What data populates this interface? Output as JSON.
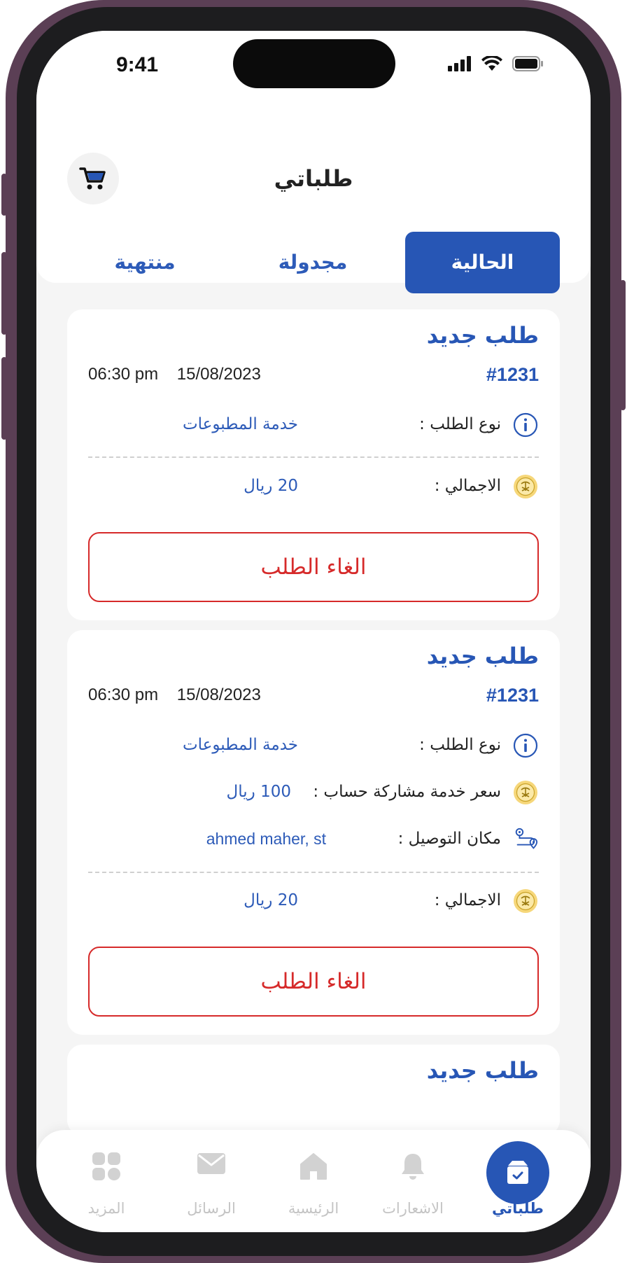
{
  "status_bar": {
    "time": "9:41"
  },
  "header": {
    "title": "طلباتي"
  },
  "tabs": [
    {
      "label": "الحالية",
      "active": true
    },
    {
      "label": "مجدولة",
      "active": false
    },
    {
      "label": "منتهية",
      "active": false
    }
  ],
  "orders": [
    {
      "title": "طلب جديد",
      "id": "#1231",
      "date": "15/08/2023",
      "time": "06:30 pm",
      "type_label": "نوع الطلب :",
      "type_value": "خدمة المطبوعات",
      "total_label": "الاجمالي :",
      "total_value": "20 ريال",
      "cancel_label": "الغاء الطلب"
    },
    {
      "title": "طلب جديد",
      "id": "#1231",
      "date": "15/08/2023",
      "time": "06:30 pm",
      "type_label": "نوع الطلب :",
      "type_value": "خدمة المطبوعات",
      "price_label": "سعر خدمة مشاركة حساب :",
      "price_value": "100 ريال",
      "location_label": "مكان التوصيل :",
      "location_value": "ahmed maher, st",
      "total_label": "الاجمالي :",
      "total_value": "20 ريال",
      "cancel_label": "الغاء الطلب"
    },
    {
      "title": "طلب جديد"
    }
  ],
  "bottom_nav": [
    {
      "label": "طلباتي",
      "icon": "box-icon",
      "active": true
    },
    {
      "label": "الاشعارات",
      "icon": "bell-icon",
      "active": false
    },
    {
      "label": "الرئيسية",
      "icon": "home-icon",
      "active": false
    },
    {
      "label": "الرسائل",
      "icon": "mail-icon",
      "active": false
    },
    {
      "label": "المزيد",
      "icon": "grid-icon",
      "active": false
    }
  ],
  "colors": {
    "primary": "#2756b5",
    "danger": "#d62a2a",
    "coin": "#f6d77a"
  }
}
